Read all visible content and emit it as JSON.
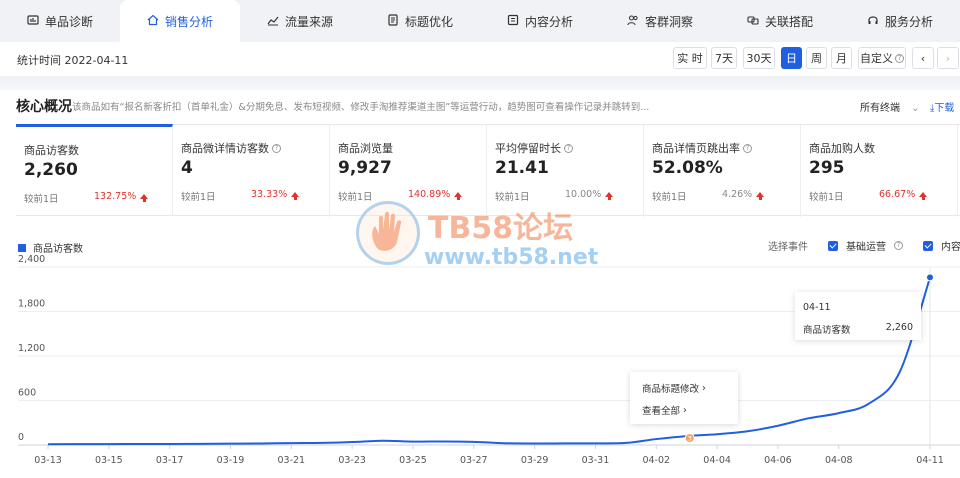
{
  "tabs": [
    {
      "label": "单品诊断",
      "icon": "dashboard-icon"
    },
    {
      "label": "销售分析",
      "icon": "home-icon",
      "active": true
    },
    {
      "label": "流量来源",
      "icon": "trend-icon"
    },
    {
      "label": "标题优化",
      "icon": "doc-icon"
    },
    {
      "label": "内容分析",
      "icon": "list-icon"
    },
    {
      "label": "客群洞察",
      "icon": "users-icon"
    },
    {
      "label": "关联搭配",
      "icon": "link-icon"
    },
    {
      "label": "服务分析",
      "icon": "headset-icon"
    }
  ],
  "time": {
    "label": "统计时间 2022-04-11",
    "periods": [
      "实 时",
      "7天",
      "30天",
      "日",
      "周",
      "月",
      "自定义"
    ],
    "active_period": "日",
    "prev": "‹",
    "next": "›"
  },
  "core": {
    "title": "核心概况",
    "desc": "该商品如有“报名新客折扣（首单礼金）&分期免息、发布短视频、修改手淘推荐渠道主图”等运营行动，趋势图可查看操作记录并跳转到...",
    "terminal": "所有终端",
    "download": "下载"
  },
  "metrics": [
    {
      "label": "商品访客数",
      "value": "2,260",
      "prev": "较前1日",
      "change": "132.75%",
      "help": false,
      "up": true,
      "active": true
    },
    {
      "label": "商品微详情访客数",
      "value": "4",
      "prev": "较前1日",
      "change": "33.33%",
      "help": true,
      "up": true
    },
    {
      "label": "商品浏览量",
      "value": "9,927",
      "prev": "较前1日",
      "change": "140.89%",
      "help": false,
      "up": true
    },
    {
      "label": "平均停留时长",
      "value": "21.41",
      "prev": "较前1日",
      "change": "10.00%",
      "help": true,
      "up": true,
      "grey": true
    },
    {
      "label": "商品详情页跳出率",
      "value": "52.08%",
      "prev": "较前1日",
      "change": "4.26%",
      "help": true,
      "up": true,
      "grey": true
    },
    {
      "label": "商品加购人数",
      "value": "295",
      "prev": "较前1日",
      "change": "66.67%",
      "help": false,
      "up": true
    }
  ],
  "legend": {
    "series": "商品访客数",
    "color": "#1f5fe0"
  },
  "events": {
    "label": "选择事件",
    "items": [
      "基础运营",
      "内容运营"
    ]
  },
  "tooltip": {
    "date": "04-11",
    "metric": "商品访客数",
    "value": "2,260"
  },
  "popup": {
    "items": [
      "商品标题修改",
      "查看全部"
    ]
  },
  "watermark": {
    "title": "TB58论坛",
    "url": "www.tb58.net"
  },
  "chart_data": {
    "type": "line",
    "x": [
      "03-13",
      "03-14",
      "03-15",
      "03-16",
      "03-17",
      "03-18",
      "03-19",
      "03-20",
      "03-21",
      "03-22",
      "03-23",
      "03-24",
      "03-25",
      "03-26",
      "03-27",
      "03-28",
      "03-29",
      "03-30",
      "03-31",
      "04-01",
      "04-02",
      "04-03",
      "04-04",
      "04-05",
      "04-06",
      "04-07",
      "04-08",
      "04-09",
      "04-10",
      "04-11"
    ],
    "x_tick_labels": [
      "03-13",
      "03-15",
      "03-17",
      "03-19",
      "03-21",
      "03-23",
      "03-25",
      "03-27",
      "03-29",
      "03-31",
      "04-02",
      "04-04",
      "04-06",
      "04-08",
      "04-11"
    ],
    "series": [
      {
        "name": "商品访客数",
        "values": [
          10,
          12,
          12,
          14,
          14,
          16,
          18,
          20,
          26,
          28,
          40,
          58,
          45,
          48,
          42,
          24,
          20,
          22,
          22,
          28,
          80,
          120,
          145,
          185,
          260,
          360,
          430,
          560,
          980,
          2260
        ],
        "color": "#1f5fe0"
      }
    ],
    "y_ticks": [
      0,
      600,
      1200,
      1800,
      2400
    ],
    "y_tick_labels": [
      "0",
      "600",
      "1,200",
      "1,800",
      "2,400"
    ],
    "ylim": [
      0,
      2400
    ],
    "grid": true,
    "event_marker_x": "04-03",
    "event_marker_label": "3"
  }
}
